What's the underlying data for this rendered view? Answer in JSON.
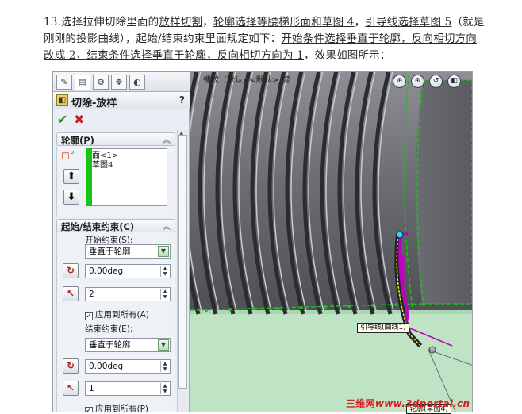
{
  "document": {
    "line1_a": "13.选择拉伸切除里面的",
    "line1_link1": "放样切割",
    "line1_sep1": "，",
    "line1_link2": "轮廓选择等腰梯形面和草图 4",
    "line1_sep2": "，",
    "line1_link3": "引导线选择草图 5",
    "line1_b": "（就是",
    "line2_a": "刚刚的投影曲线），起始/结束约束里面规定如下：",
    "line2_link": "开始条件选择垂直于轮廓，反向相切方向",
    "line3_link": "改成 2，结束条件选择垂直于轮廓，反向相切方向为 1",
    "line3_b": "，效果如图所示："
  },
  "property_manager": {
    "title": "切除-放样",
    "help": "?",
    "tabs": [
      "feature-manager",
      "property-manager",
      "configuration-manager",
      "dimxpert-manager",
      "display-manager"
    ],
    "ok_icon": "✔",
    "cancel_icon": "✖",
    "profiles_group": {
      "title": "轮廓(P)",
      "items": [
        "面<1>",
        "草图4"
      ]
    },
    "constraints_group": {
      "title": "起始/结束约束(C)",
      "start_label": "开始约束(S):",
      "start_value": "垂直于轮廓",
      "start_angle": "0.00deg",
      "start_tangent_length": "2",
      "start_apply_all": "应用到所有(A)",
      "end_label": "结束约束(E):",
      "end_value": "垂直于轮廓",
      "end_angle": "0.00deg",
      "end_tangent_length": "1",
      "end_apply_all": "应用到所有(P)"
    }
  },
  "graphics": {
    "tree_text": "螺纹（默认<<默认>_显",
    "callout_guide": "引导线(曲线1)",
    "callout_profile": "轮廓(草图4)"
  },
  "watermark": {
    "cn": "三维网",
    "url": "www.3dportal.cn"
  },
  "colors": {
    "graphics_bg": "#bfe4c5",
    "cylinder": "#6a6c72",
    "profile_green": "#19c419",
    "guide_magenta": "#c000c0",
    "watermark_red": "#d42020"
  }
}
